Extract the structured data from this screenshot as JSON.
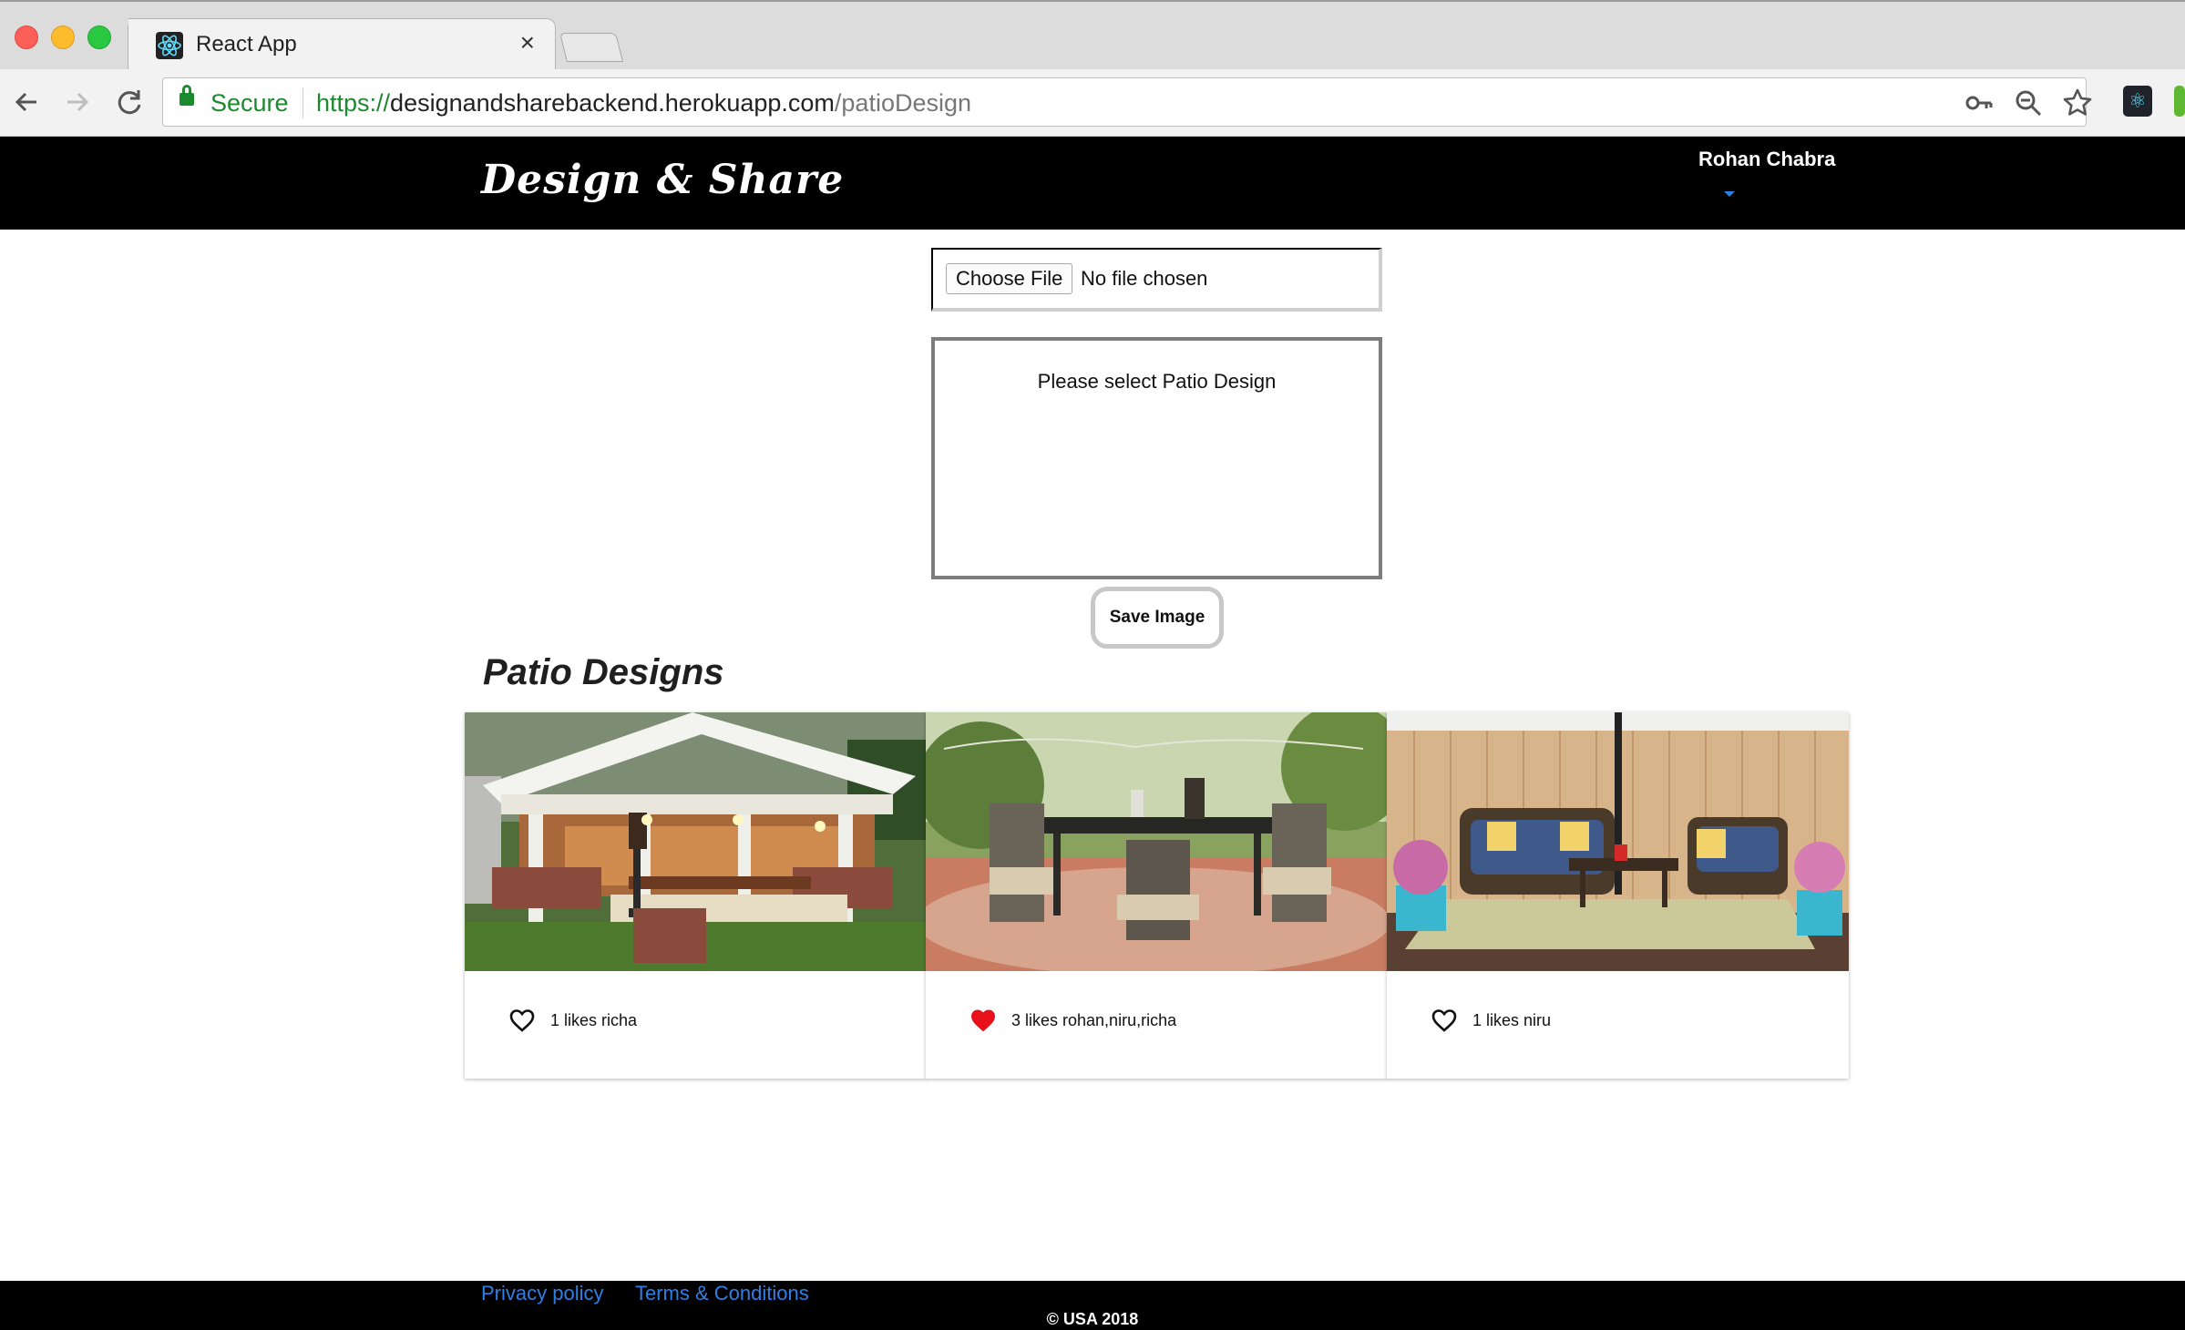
{
  "browser": {
    "tab_title": "React App",
    "tab_close": "×",
    "secure_label": "Secure",
    "url_scheme": "https://",
    "url_host": "designandsharebackend.herokuapp.com",
    "url_path": "/patioDesign"
  },
  "header": {
    "brand": "Design & Share",
    "user_name": "Rohan Chabra"
  },
  "upload": {
    "choose_file_label": "Choose File",
    "file_status": "No file chosen",
    "preview_placeholder": "Please select Patio Design",
    "save_label": "Save Image"
  },
  "gallery": {
    "title": "Patio Designs",
    "cards": [
      {
        "likes_text": "1 likes richa",
        "liked": false
      },
      {
        "likes_text": "3 likes rohan,niru,richa",
        "liked": true
      },
      {
        "likes_text": "1 likes niru",
        "liked": false
      }
    ]
  },
  "footer": {
    "privacy_label": "Privacy policy",
    "terms_label": "Terms & Conditions",
    "copyright": "© USA 2018"
  },
  "colors": {
    "link_blue": "#2f7fe6",
    "liked_red": "#e8101a",
    "secure_green": "#1c8a2e"
  }
}
